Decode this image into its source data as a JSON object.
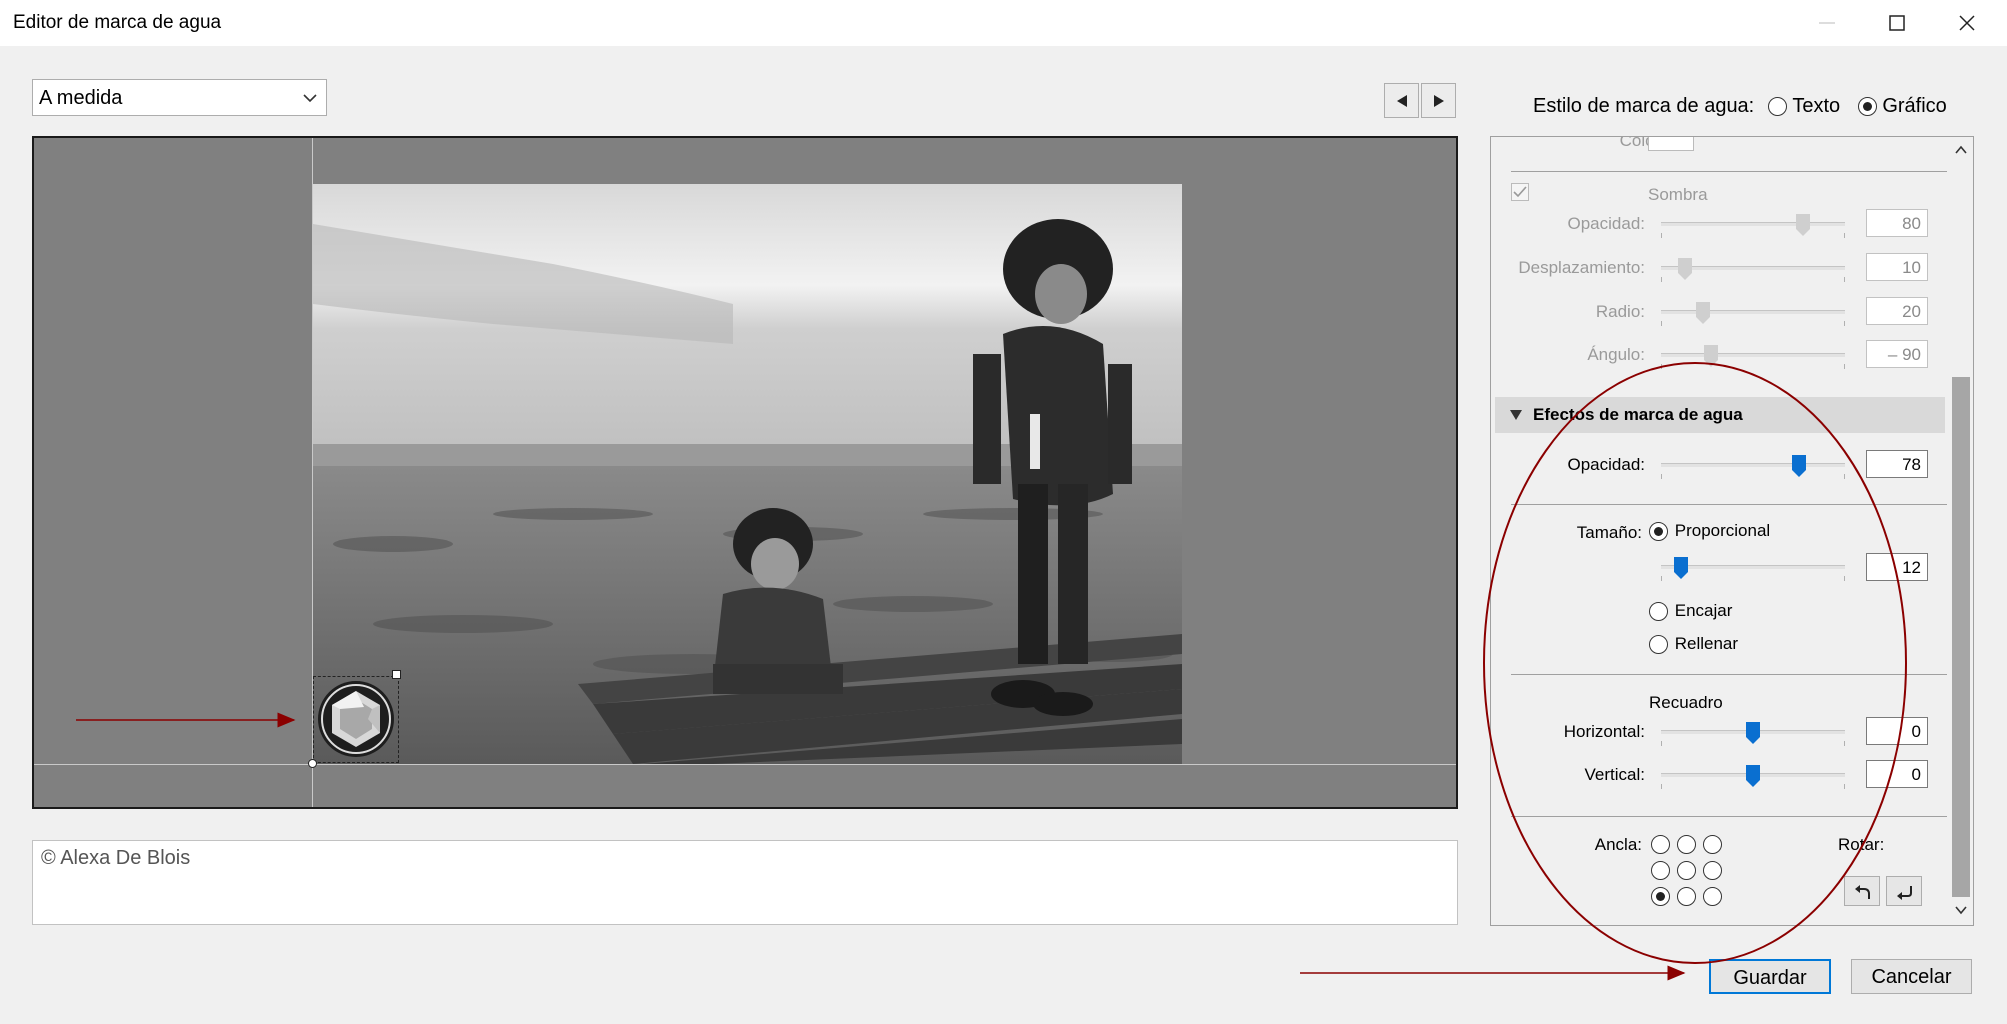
{
  "window": {
    "title": "Editor de marca de agua"
  },
  "toolbar": {
    "preset_value": "A medida"
  },
  "watermark_style": {
    "label": "Estilo de marca de agua:",
    "options": [
      "Texto",
      "Gráfico"
    ],
    "selected": "Gráfico"
  },
  "caption": {
    "text": "© Alexa De Blois"
  },
  "shadow": {
    "color_label": "Color:",
    "title": "Sombra",
    "checked": true,
    "opacity_label": "Opacidad:",
    "opacity_value": "80",
    "opacity_pct": 0.77,
    "offset_label": "Desplazamiento:",
    "offset_value": "10",
    "offset_pct": 0.13,
    "radius_label": "Radio:",
    "radius_value": "20",
    "radius_pct": 0.23,
    "angle_label": "Ángulo:",
    "angle_value": "– 90",
    "angle_pct": 0.27
  },
  "effects": {
    "title": "Efectos de marca de agua",
    "opacity_label": "Opacidad:",
    "opacity_value": "78",
    "opacity_pct": 0.75,
    "size_label": "Tamaño:",
    "size_options": [
      "Proporcional",
      "Encajar",
      "Rellenar"
    ],
    "size_selected": "Proporcional",
    "size_value": "12",
    "size_pct": 0.11,
    "inset_title": "Recuadro",
    "horizontal_label": "Horizontal:",
    "horizontal_value": "0",
    "horizontal_pct": 0.5,
    "vertical_label": "Vertical:",
    "vertical_value": "0",
    "vertical_pct": 0.5,
    "anchor_label": "Ancla:",
    "anchor_selected": "bottom-left",
    "rotate_label": "Rotar:"
  },
  "buttons": {
    "save": "Guardar",
    "cancel": "Cancelar"
  },
  "colors": {
    "accent": "#0078d7",
    "annotation": "#8b0000",
    "preview_bg": "#808080"
  }
}
